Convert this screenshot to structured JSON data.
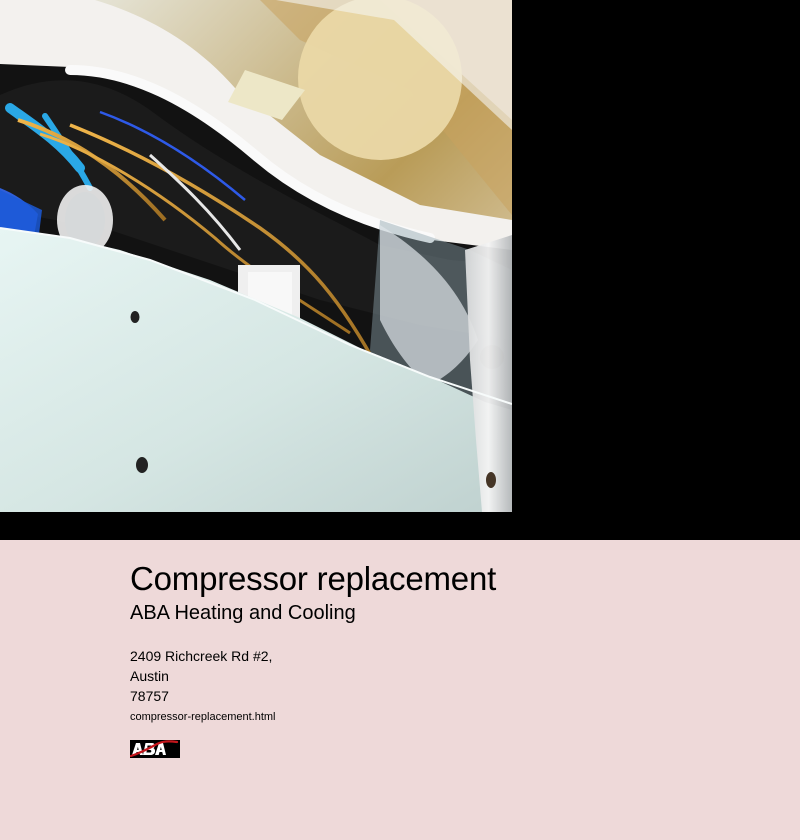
{
  "hero": {
    "image_subject": "open air conditioner unit with internal wiring"
  },
  "content": {
    "title": "Compressor replacement",
    "company": "ABA Heating and Cooling",
    "address": {
      "street": "2409 Richcreek Rd #2,",
      "city": "Austin",
      "zip": "78757"
    },
    "link_text": "compressor-replacement.html",
    "logo_text": "ABA"
  },
  "colors": {
    "page_background": "#eed9d9",
    "hero_background": "#000000",
    "text": "#000000",
    "logo_red": "#c4161c"
  }
}
